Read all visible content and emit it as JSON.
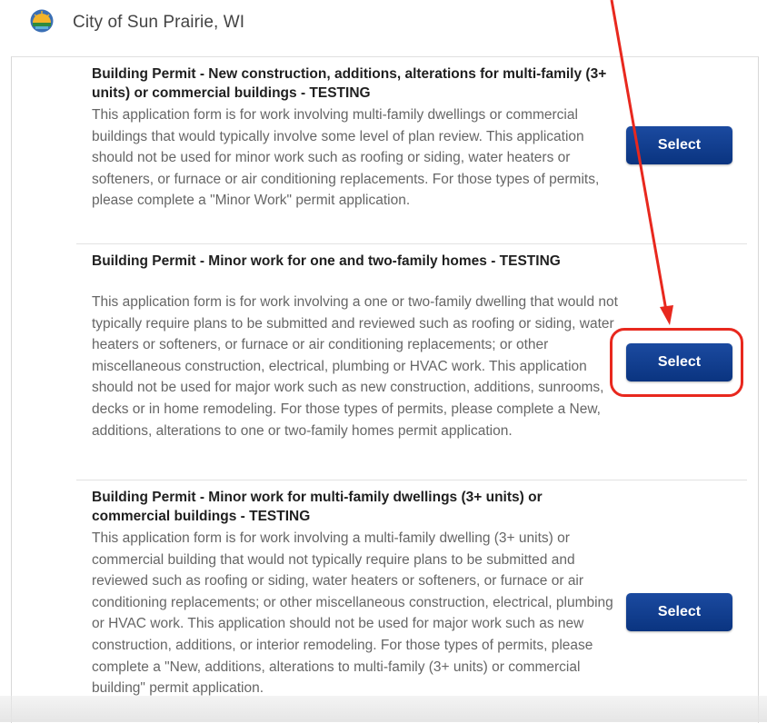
{
  "header": {
    "city_title": "City of Sun Prairie, WI"
  },
  "permits": [
    {
      "title": "Building Permit - New construction, additions, alterations for multi-family (3+ units) or commercial buildings - TESTING",
      "description": "This application form is for work involving multi-family dwellings or commercial buildings that would typically involve some level of plan review. This application should not be used for minor work such as roofing or siding, water heaters or softeners, or furnace or air conditioning replacements. For those types of permits, please complete a \"Minor Work\" permit application.",
      "button_label": "Select"
    },
    {
      "title": "Building Permit - Minor work for one and two-family homes - TESTING",
      "description": "This application form is for work involving a one or two-family dwelling that would not typically require plans to be submitted and reviewed such as roofing or siding, water heaters or softeners, or furnace or air conditioning replacements; or other miscellaneous construction, electrical, plumbing or HVAC work. This application should not be used for major work such as new construction, additions, sunrooms, decks or in home remodeling. For those types of permits, please complete a New, additions, alterations to one or two-family homes permit application.",
      "button_label": "Select"
    },
    {
      "title": "Building Permit - Minor work for multi-family dwellings (3+ units) or commercial buildings - TESTING",
      "description": "This application form is for work involving a multi-family dwelling (3+ units) or commercial building that would not typically require plans to be submitted and reviewed such as roofing or siding, water heaters or softeners, or furnace or air conditioning replacements; or other miscellaneous construction, electrical, plumbing or HVAC work. This application should not be used for major work such as new construction, additions, or interior remodeling. For those types of permits, please complete a \"New, additions, alterations to multi-family (3+ units) or commercial building\" permit application.",
      "button_label": "Select"
    }
  ],
  "colors": {
    "button": "#0d3a8a",
    "annotation": "#e8281e",
    "description_text": "#666666"
  }
}
